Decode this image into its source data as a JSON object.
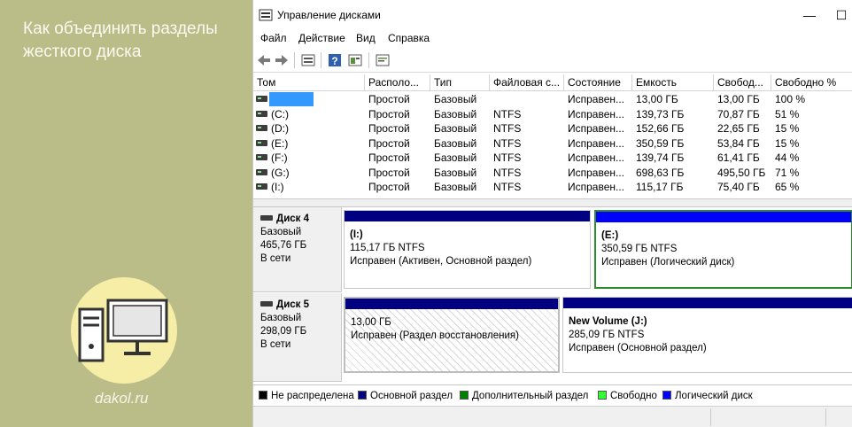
{
  "banner": {
    "title": "Как объединить разделы жесткого диска",
    "site": "dakol.ru"
  },
  "window": {
    "title": "Управление дисками",
    "minimize_glyph": "—",
    "maximize_glyph": "☐"
  },
  "menu": [
    "Файл",
    "Действие",
    "Вид",
    "Справка"
  ],
  "toolbar_icons": [
    "back-icon",
    "forward-icon",
    "disk-list-icon",
    "help-icon",
    "properties-icon",
    "console-icon"
  ],
  "table": {
    "columns": [
      "Том",
      "Располо...",
      "Тип",
      "Файловая с...",
      "Состояние",
      "Емкость",
      "Свобод...",
      "Свободно %"
    ],
    "rows": [
      {
        "vol": "",
        "layout": "Простой",
        "type": "Базовый",
        "fs": "",
        "status": "Исправен...",
        "capacity": "13,00 ГБ",
        "free": "13,00 ГБ",
        "pct": "100 %"
      },
      {
        "vol": "(C:)",
        "layout": "Простой",
        "type": "Базовый",
        "fs": "NTFS",
        "status": "Исправен...",
        "capacity": "139,73 ГБ",
        "free": "70,87 ГБ",
        "pct": "51 %"
      },
      {
        "vol": "(D:)",
        "layout": "Простой",
        "type": "Базовый",
        "fs": "NTFS",
        "status": "Исправен...",
        "capacity": "152,66 ГБ",
        "free": "22,65 ГБ",
        "pct": "15 %"
      },
      {
        "vol": "(E:)",
        "layout": "Простой",
        "type": "Базовый",
        "fs": "NTFS",
        "status": "Исправен...",
        "capacity": "350,59 ГБ",
        "free": "53,84 ГБ",
        "pct": "15 %"
      },
      {
        "vol": "(F:)",
        "layout": "Простой",
        "type": "Базовый",
        "fs": "NTFS",
        "status": "Исправен...",
        "capacity": "139,74 ГБ",
        "free": "61,41 ГБ",
        "pct": "44 %"
      },
      {
        "vol": "(G:)",
        "layout": "Простой",
        "type": "Базовый",
        "fs": "NTFS",
        "status": "Исправен...",
        "capacity": "698,63 ГБ",
        "free": "495,50 ГБ",
        "pct": "71 %"
      },
      {
        "vol": "(I:)",
        "layout": "Простой",
        "type": "Базовый",
        "fs": "NTFS",
        "status": "Исправен...",
        "capacity": "115,17 ГБ",
        "free": "75,40 ГБ",
        "pct": "65 %"
      }
    ]
  },
  "disks": [
    {
      "name": "Диск 4",
      "type": "Базовый",
      "size": "465,76 ГБ",
      "state": "В сети",
      "partitions": [
        {
          "name": "(I:)",
          "size": "115,17 ГБ NTFS",
          "status": "Исправен (Активен, Основной раздел)",
          "bar_color": "#000080"
        },
        {
          "name": "(E:)",
          "size": "350,59 ГБ NTFS",
          "status": "Исправен (Логический диск)",
          "bar_color": "#0000ff"
        }
      ]
    },
    {
      "name": "Диск 5",
      "type": "Базовый",
      "size": "298,09 ГБ",
      "state": "В сети",
      "partitions": [
        {
          "name": "",
          "size": "13,00 ГБ",
          "status": "Исправен (Раздел восстановления)",
          "bar_color": "#000080"
        },
        {
          "name": "New Volume  (J:)",
          "size": "285,09 ГБ NTFS",
          "status": "Исправен (Основной раздел)",
          "bar_color": "#000080"
        }
      ]
    }
  ],
  "legend": [
    {
      "label": "Не распределена",
      "color": "#000000"
    },
    {
      "label": "Основной раздел",
      "color": "#000080"
    },
    {
      "label": "Дополнительный раздел",
      "color": "#008000"
    },
    {
      "label": "Свободно",
      "color": "#33ff33"
    },
    {
      "label": "Логический диск",
      "color": "#0000ff"
    }
  ],
  "colors": {
    "banner_bg": "#bbbd89",
    "selection": "#3399ff",
    "extended_border": "#2e8b2e"
  }
}
